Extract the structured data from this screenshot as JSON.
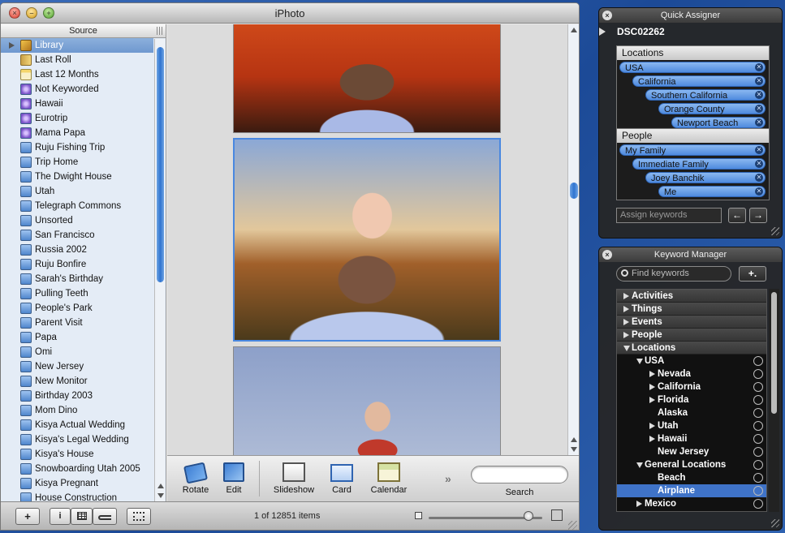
{
  "window": {
    "title": "iPhoto"
  },
  "source": {
    "header": "Source",
    "items": [
      {
        "label": "Library",
        "icon": "library-icon",
        "selected": true
      },
      {
        "label": "Last Roll",
        "icon": "film-roll-icon"
      },
      {
        "label": "Last 12 Months",
        "icon": "calendar-icon"
      },
      {
        "label": "Not Keyworded",
        "icon": "smart-album-icon"
      },
      {
        "label": "Hawaii",
        "icon": "smart-album-icon"
      },
      {
        "label": "Eurotrip",
        "icon": "smart-album-icon"
      },
      {
        "label": "Mama Papa",
        "icon": "smart-album-icon"
      },
      {
        "label": "Ruju Fishing Trip",
        "icon": "album-icon"
      },
      {
        "label": "Trip Home",
        "icon": "album-icon"
      },
      {
        "label": "The Dwight House",
        "icon": "album-icon"
      },
      {
        "label": "Utah",
        "icon": "album-icon"
      },
      {
        "label": "Telegraph Commons",
        "icon": "album-icon"
      },
      {
        "label": "Unsorted",
        "icon": "album-icon"
      },
      {
        "label": "San Francisco",
        "icon": "album-icon"
      },
      {
        "label": "Russia 2002",
        "icon": "album-icon"
      },
      {
        "label": "Ruju Bonfire",
        "icon": "album-icon"
      },
      {
        "label": "Sarah's Birthday",
        "icon": "album-icon"
      },
      {
        "label": "Pulling Teeth",
        "icon": "album-icon"
      },
      {
        "label": "People's Park",
        "icon": "album-icon"
      },
      {
        "label": "Parent Visit",
        "icon": "album-icon"
      },
      {
        "label": "Papa",
        "icon": "album-icon"
      },
      {
        "label": "Omi",
        "icon": "album-icon"
      },
      {
        "label": "New Jersey",
        "icon": "album-icon"
      },
      {
        "label": "New Monitor",
        "icon": "album-icon"
      },
      {
        "label": "Birthday 2003",
        "icon": "album-icon"
      },
      {
        "label": "Mom Dino",
        "icon": "album-icon"
      },
      {
        "label": "Kisya Actual Wedding",
        "icon": "album-icon"
      },
      {
        "label": "Kisya's Legal Wedding",
        "icon": "album-icon"
      },
      {
        "label": "Kisya's House",
        "icon": "album-icon"
      },
      {
        "label": "Snowboarding Utah 2005",
        "icon": "album-icon"
      },
      {
        "label": "Kisya Pregnant",
        "icon": "album-icon"
      },
      {
        "label": "House Construction",
        "icon": "album-icon"
      }
    ]
  },
  "toolbar": {
    "rotate": "Rotate",
    "edit": "Edit",
    "slideshow": "Slideshow",
    "card": "Card",
    "calendar": "Calendar",
    "more": "»",
    "search_label": "Search",
    "search_value": ""
  },
  "bottombar": {
    "add": "+",
    "info": "i",
    "count": "1 of 12851 items"
  },
  "quick_assigner": {
    "title": "Quick Assigner",
    "photo_name": "DSC02262",
    "locations_header": "Locations",
    "locations": [
      "USA",
      "California",
      "Southern California",
      "Orange County",
      "Newport Beach"
    ],
    "people_header": "People",
    "people": [
      "My Family",
      "Immediate Family",
      "Joey Banchik",
      "Me"
    ],
    "input_placeholder": "Assign keywords",
    "prev": "←",
    "next": "→"
  },
  "keyword_manager": {
    "title": "Keyword Manager",
    "search_placeholder": "Find keywords",
    "add_button": "+.",
    "rows": [
      {
        "label": "Activities",
        "type": "category",
        "state": "collapsed"
      },
      {
        "label": "Things",
        "type": "category",
        "state": "collapsed"
      },
      {
        "label": "Events",
        "type": "category",
        "state": "collapsed"
      },
      {
        "label": "People",
        "type": "category",
        "state": "collapsed"
      },
      {
        "label": "Locations",
        "type": "category",
        "state": "expanded"
      },
      {
        "label": "USA",
        "level": 1,
        "state": "expanded"
      },
      {
        "label": "Nevada",
        "level": 2,
        "state": "collapsed"
      },
      {
        "label": "California",
        "level": 2,
        "state": "collapsed"
      },
      {
        "label": "Florida",
        "level": 2,
        "state": "collapsed"
      },
      {
        "label": "Alaska",
        "level": 2,
        "state": "leaf"
      },
      {
        "label": "Utah",
        "level": 2,
        "state": "collapsed"
      },
      {
        "label": "Hawaii",
        "level": 2,
        "state": "collapsed"
      },
      {
        "label": "New Jersey",
        "level": 2,
        "state": "leaf"
      },
      {
        "label": "General Locations",
        "level": 1,
        "state": "expanded"
      },
      {
        "label": "Beach",
        "level": 2,
        "state": "leaf"
      },
      {
        "label": "Airplane",
        "level": 2,
        "state": "leaf",
        "selected": true
      },
      {
        "label": "Mexico",
        "level": 1,
        "state": "collapsed"
      }
    ]
  },
  "colors": {
    "selection": "#3f73c8",
    "pill": "#4f8ade",
    "hud_bg": "#262626"
  }
}
